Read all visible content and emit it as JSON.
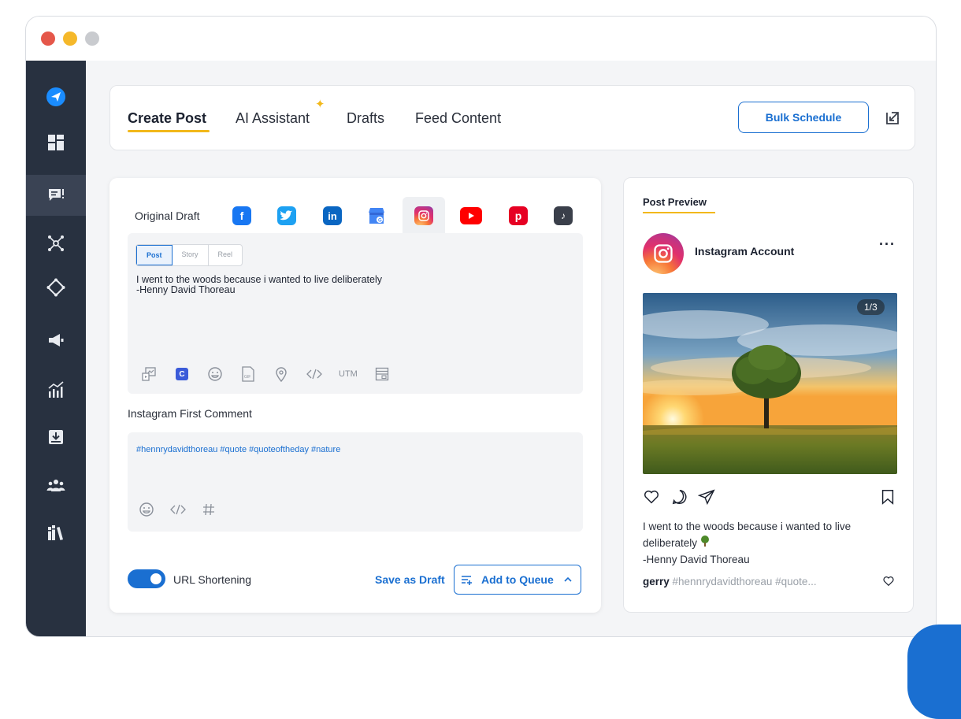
{
  "tabs": {
    "create_post": "Create Post",
    "ai_assistant": "AI Assistant",
    "drafts": "Drafts",
    "feed_content": "Feed Content"
  },
  "header": {
    "bulk_schedule": "Bulk Schedule"
  },
  "editor": {
    "original_draft": "Original Draft",
    "networks": [
      "facebook",
      "twitter",
      "linkedin",
      "google-business",
      "instagram",
      "youtube",
      "pinterest",
      "tiktok"
    ],
    "active_network": "instagram",
    "post_types": {
      "post": "Post",
      "story": "Story",
      "reel": "Reel"
    },
    "post_text": "I went to the woods because i wanted to live deliberately\n-Henny David Thoreau",
    "utm_label": "UTM",
    "first_comment_label": "Instagram First Comment",
    "first_comment_text": "#hennrydavidthoreau #quote #quoteoftheday #nature",
    "url_shortening_label": "URL Shortening",
    "url_shortening_on": true,
    "save_as_draft": "Save as Draft",
    "add_to_queue": "Add to Queue"
  },
  "preview": {
    "title": "Post Preview",
    "account_name": "Instagram Account",
    "image_counter": "1/3",
    "caption_line1": "I went to the woods because i wanted to live",
    "caption_line2": "deliberately",
    "caption_line3": "-Henny David Thoreau",
    "footer_user": "gerry",
    "footer_tags": " #hennrydavidthoreau #quote..."
  },
  "colors": {
    "accent": "#1a6fd1",
    "highlight": "#f2b81b",
    "sidebar": "#283140"
  }
}
